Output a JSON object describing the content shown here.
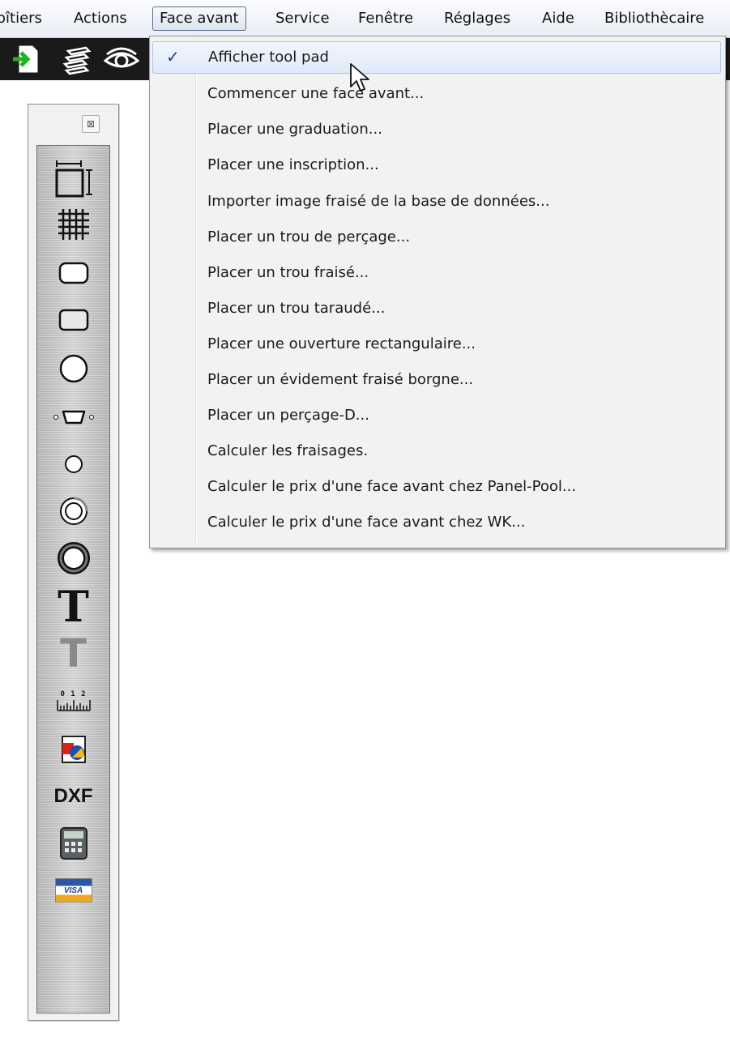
{
  "menubar": {
    "items": [
      {
        "label": "oîtiers"
      },
      {
        "label": "Actions"
      },
      {
        "label": "Face avant"
      },
      {
        "label": "Service"
      },
      {
        "label": "Fenêtre"
      },
      {
        "label": "Réglages"
      },
      {
        "label": "Aide"
      },
      {
        "label": "Bibliothècaire"
      }
    ],
    "active_index": 2
  },
  "toolbar": {
    "icons": [
      "new-file-arrow-icon",
      "layers-icon",
      "eye-icon"
    ]
  },
  "toolpad": {
    "close_glyph": "⊠",
    "tools": [
      "dimensions-icon",
      "grid-icon",
      "rounded-rect-icon",
      "rect-cutout-icon",
      "round-hole-icon",
      "d-sub-icon",
      "small-hole-icon",
      "countersink-icon",
      "thick-ring-icon",
      "text-bold-icon",
      "text-engraved-icon",
      "scale-icon",
      "image-import-icon",
      "dxf-icon",
      "calculator-icon",
      "visa-card-icon"
    ],
    "dxf_label": "DXF",
    "text_glyph": "T",
    "scale_label": "0 1 2",
    "visa_label": "VISA"
  },
  "dropdown": {
    "items": [
      {
        "label": "Afficher tool pad",
        "checked": true
      },
      {
        "label": "Commencer une face avant..."
      },
      {
        "label": "Placer une graduation..."
      },
      {
        "label": "Placer une inscription..."
      },
      {
        "label": "Importer image fraisé de la base de données..."
      },
      {
        "label": "Placer un trou de perçage..."
      },
      {
        "label": "Placer un trou fraisé..."
      },
      {
        "label": "Placer un trou taraudé..."
      },
      {
        "label": "Placer une ouverture rectangulaire..."
      },
      {
        "label": "Placer un évidement fraisé borgne..."
      },
      {
        "label": "Placer un perçage-D..."
      },
      {
        "label": "Calculer les fraisages."
      },
      {
        "label": "Calculer le prix d'une face avant chez Panel-Pool..."
      },
      {
        "label": "Calculer le prix d'une face avant chez WK..."
      }
    ],
    "check_glyph": "✓"
  },
  "colors": {
    "menu_highlight": "#dfeaf9",
    "toolbar_bg": "#1a1a1a"
  }
}
